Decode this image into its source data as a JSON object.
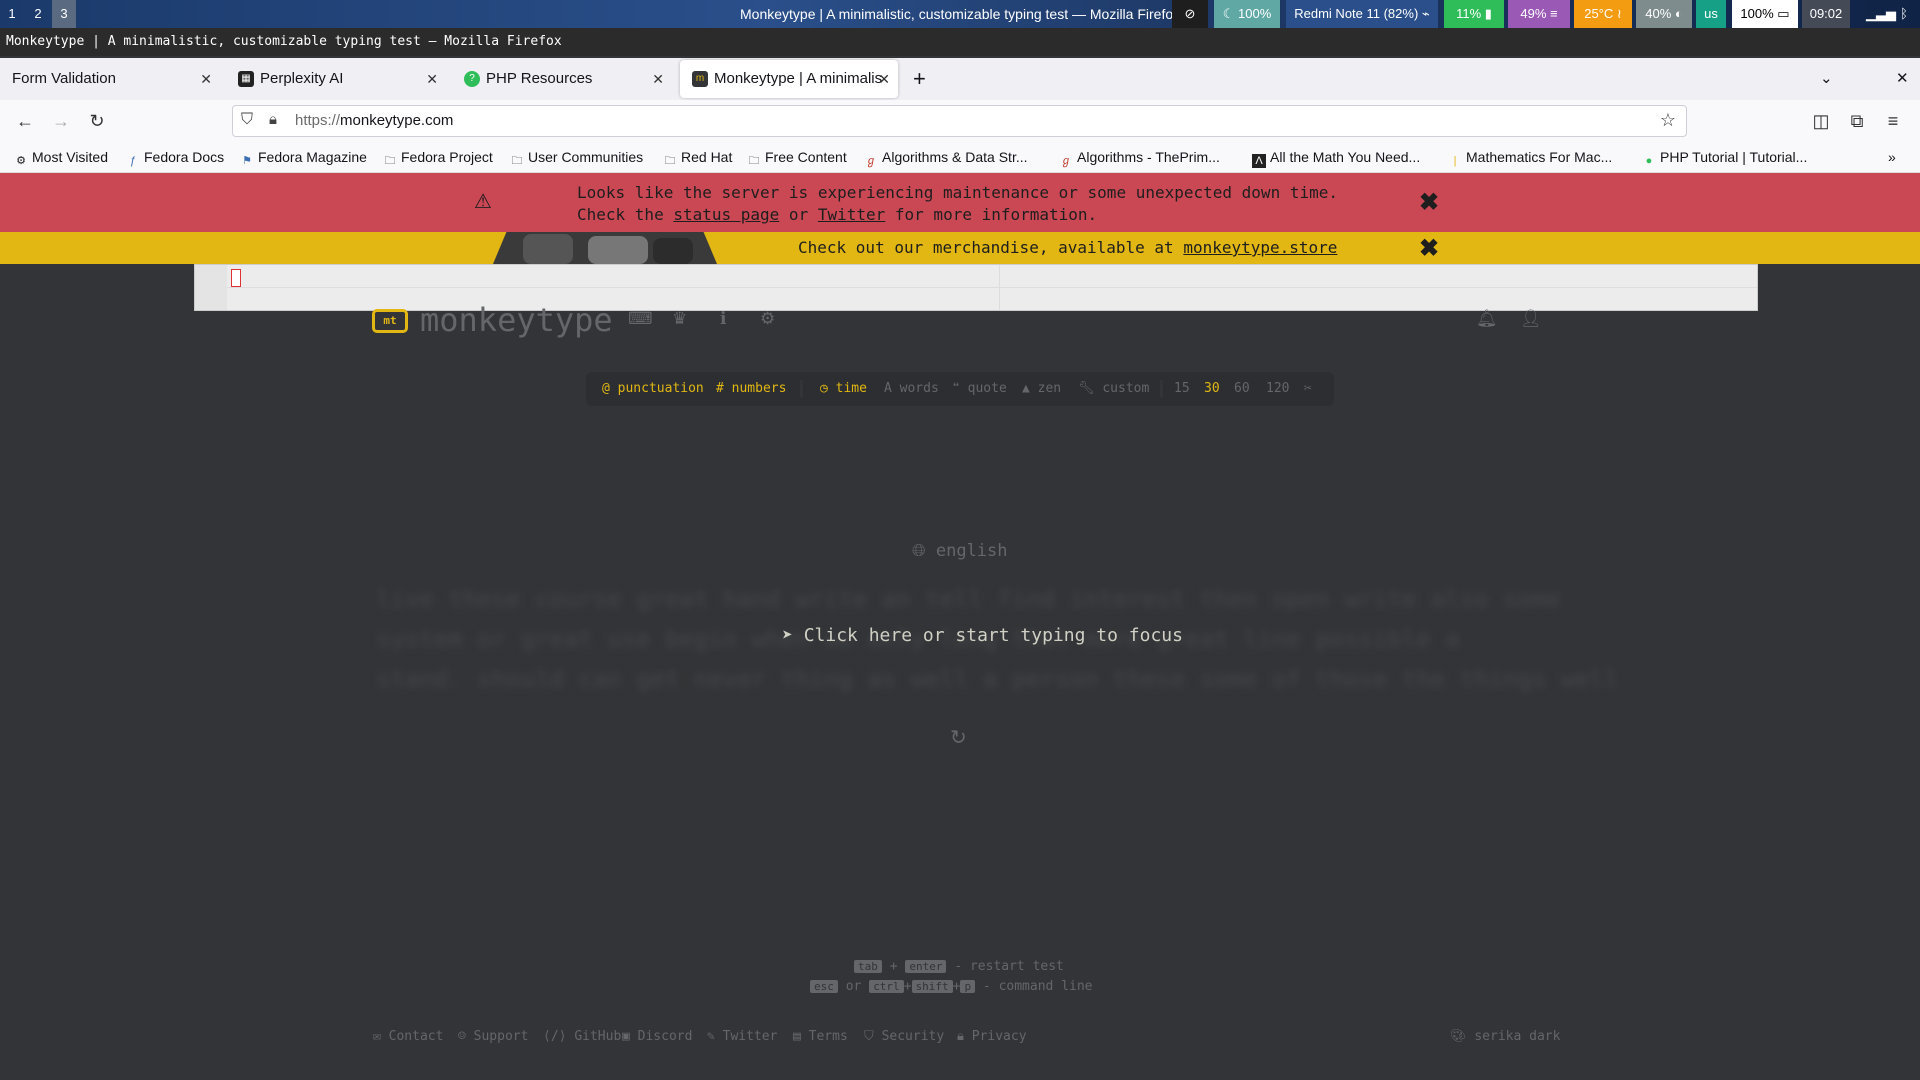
{
  "topbar": {
    "workspaces": [
      "1",
      "2",
      "3"
    ],
    "title": "Monkeytype | A minimalistic, customizable typing test — Mozilla Firefox",
    "blocks": [
      {
        "text": "⊘",
        "bg": "#1e1e1e",
        "fg": "#ffffff"
      },
      {
        "text": "☾ 100%",
        "bg": "#5fa8a4",
        "fg": "#ffffff"
      },
      {
        "text": "Redmi Note 11 (82%) ⌁",
        "bg": "#2a4f8a",
        "fg": "#ffffff"
      },
      {
        "text": "11% ▮",
        "bg": "#2ebd59",
        "fg": "#ffffff"
      },
      {
        "text": "49% ≡",
        "bg": "#9b59b6",
        "fg": "#ffffff"
      },
      {
        "text": "25°C ≀",
        "bg": "#f39c12",
        "fg": "#ffffff"
      },
      {
        "text": "40% ◐",
        "bg": "#7f8c8d",
        "fg": "#ffffff"
      },
      {
        "text": "us",
        "bg": "#16a085",
        "fg": "#ffffff"
      },
      {
        "text": "100% ▭",
        "bg": "#ffffff",
        "fg": "#000000"
      },
      {
        "text": "09:02",
        "bg": "#444b57",
        "fg": "#ffffff"
      }
    ]
  },
  "window_title": "Monkeytype | A minimalistic, customizable typing test — Mozilla Firefox",
  "tabs": [
    {
      "label": "Form Validation",
      "icon": ""
    },
    {
      "label": "Perplexity AI",
      "icon": "perplexity-icon"
    },
    {
      "label": "PHP Resources",
      "icon": "php-icon"
    },
    {
      "label": "Monkeytype | A minimalis",
      "icon": "monkeytype-icon"
    }
  ],
  "nav": {
    "url_proto": "https://",
    "url_host": "monkeytype.com"
  },
  "bookmarks": [
    {
      "label": "Most Visited",
      "icon": "gear-icon"
    },
    {
      "label": "Fedora Docs",
      "icon": "fedora-icon"
    },
    {
      "label": "Fedora Magazine",
      "icon": "fedora-magazine-icon"
    },
    {
      "label": "Fedora Project",
      "icon": "folder-icon"
    },
    {
      "label": "User Communities",
      "icon": "folder-icon"
    },
    {
      "label": "Red Hat",
      "icon": "folder-icon"
    },
    {
      "label": "Free Content",
      "icon": "folder-icon"
    },
    {
      "label": "Algorithms & Data Str...",
      "icon": "geeks-icon"
    },
    {
      "label": "Algorithms - ThePrim...",
      "icon": "geeks-icon"
    },
    {
      "label": "All the Math You Need...",
      "icon": "math-icon"
    },
    {
      "label": "Mathematics For Mac...",
      "icon": "bar-icon"
    },
    {
      "label": "PHP Tutorial | Tutorial...",
      "icon": "php-icon"
    }
  ],
  "alerts": {
    "maintenance_line1": "Looks like the server is experiencing maintenance or some unexpected down time.",
    "maintenance_line2_pre": "Check the ",
    "status_link": "status page",
    "or": " or ",
    "twitter_link": "Twitter",
    "maintenance_line2_post": " for more information.",
    "merch_pre": "Check out our merchandise, available at ",
    "merch_link": "monkeytype.store"
  },
  "app": {
    "logo_box": "mt",
    "logo_word": "monkeytype",
    "config": {
      "punctuation": "punctuation",
      "numbers": "numbers",
      "time": "time",
      "words": "words",
      "quote": "quote",
      "zen": "zen",
      "custom": "custom",
      "durations": [
        "15",
        "30",
        "60",
        "120"
      ],
      "active_duration": "30"
    },
    "language": "english",
    "blurred_lines": [
      "live these course great hand write an tell find interest then open write also some",
      "system or great use begin when we only long that more great line possible a",
      "stand. should can get never thing as well a person these some of those the things well"
    ],
    "focus_message": "Click here or start typing to focus"
  },
  "hints": {
    "tab": "tab",
    "plus": "+",
    "enter": "enter",
    "restart": "- restart test",
    "esc": "esc",
    "or": "or",
    "ctrl": "ctrl",
    "shift": "shift",
    "p": "p",
    "command": "- command line"
  },
  "footer": {
    "links": [
      "Contact",
      "Support",
      "GitHub",
      "Discord",
      "Twitter",
      "Terms",
      "Security",
      "Privacy"
    ],
    "theme": "serika dark"
  },
  "colors": {
    "accent": "#e2b714",
    "bg": "#323437",
    "sub": "#646669",
    "error": "#ca4754"
  }
}
